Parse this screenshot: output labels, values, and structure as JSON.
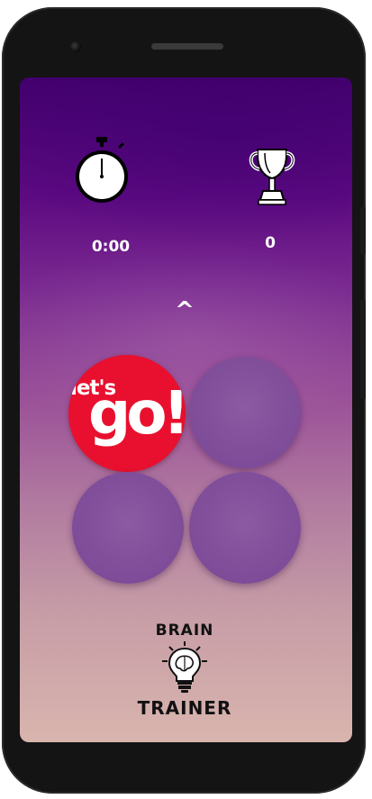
{
  "header": {
    "timer_icon": "stopwatch-icon",
    "timer_value": "0:00",
    "score_icon": "trophy-icon",
    "score_value": "0"
  },
  "question": {
    "text": "^"
  },
  "go_button": {
    "lets_text": "let's",
    "go_text": "go!",
    "color": "#e8102e"
  },
  "answers": [
    "",
    "",
    ""
  ],
  "logo": {
    "top_text": "BRAIN",
    "bottom_text": "TRAINER",
    "icon": "lightbulb-brain-icon"
  },
  "colors": {
    "screen_top": "#43006e",
    "screen_bottom": "#d9b5ae",
    "answer_bubble": "#7e4c98"
  }
}
